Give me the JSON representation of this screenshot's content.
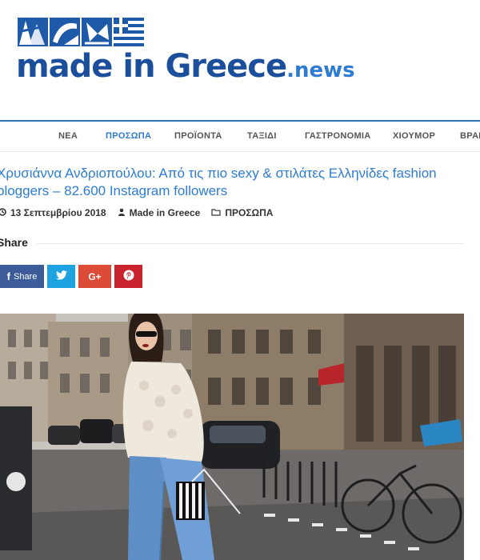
{
  "site": {
    "logo_main": "made in Greece",
    "logo_suffix": ".news"
  },
  "nav": {
    "items": [
      {
        "label": "ΝΕΑ",
        "active": false
      },
      {
        "label": "ΠΡΟΣΩΠΑ",
        "active": true
      },
      {
        "label": "ΠΡΟΪΟΝΤΑ",
        "active": false
      },
      {
        "label": "ΤΑΞΙΔΙ",
        "active": false
      },
      {
        "label": "ΓΑΣΤΡΟΝΟΜΙΑ",
        "active": false
      },
      {
        "label": "ΧΙΟΥΜΟΡ",
        "active": false
      },
      {
        "label": "ΒΡΑΒ",
        "active": false
      }
    ]
  },
  "article": {
    "title": "Χρυσιάννα Ανδριοπούλου: Από τις πιο sexy & στιλάτες Ελληνίδες fashion bloggers – 82.600 Instagram followers",
    "date": "13 Σεπτεμβρίου 2018",
    "author": "Made in Greece",
    "category": "ΠΡΟΣΩΠΑ"
  },
  "share": {
    "heading": "Share",
    "facebook_label": "Share",
    "google_label": "G+"
  },
  "colors": {
    "accent": "#2e7cd1",
    "nav_border": "#2e6fb7",
    "facebook": "#3b5b99",
    "twitter": "#1fa3e0",
    "google": "#dc4a38",
    "pinterest": "#c8232c"
  },
  "icons": {
    "date": "clock-icon",
    "author": "user-icon",
    "category": "folder-icon",
    "facebook": "facebook-icon",
    "twitter": "twitter-icon",
    "pinterest": "pinterest-icon"
  }
}
